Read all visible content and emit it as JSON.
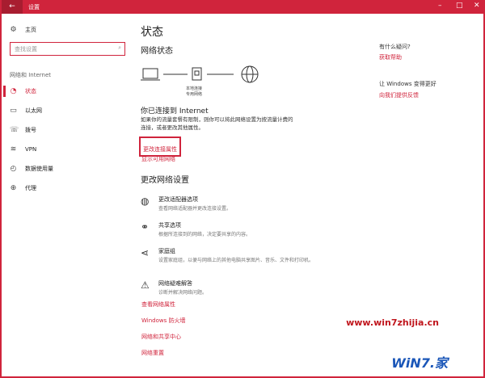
{
  "window": {
    "title": "设置",
    "minimize": "–",
    "maximize": "□",
    "close": "✕"
  },
  "sidebar": {
    "home": "主页",
    "search_placeholder": "查找设置",
    "section": "网络和 Internet",
    "items": [
      {
        "label": "状态",
        "icon": "status-icon"
      },
      {
        "label": "以太网",
        "icon": "ethernet-icon"
      },
      {
        "label": "拨号",
        "icon": "dialup-icon"
      },
      {
        "label": "VPN",
        "icon": "vpn-icon"
      },
      {
        "label": "数据使用量",
        "icon": "data-usage-icon"
      },
      {
        "label": "代理",
        "icon": "proxy-icon"
      }
    ]
  },
  "main": {
    "title": "状态",
    "network_status": "网络状态",
    "network_label_1": "本地连接",
    "network_label_2": "专用网络",
    "connected": "你已连接到 Internet",
    "connected_desc": "如果你的流量套餐有限制，则你可以将此网络设置为按流量计费的连接，或者更改其他属性。",
    "change_props": "更改连接属性",
    "show_networks": "显示可用网络",
    "change_settings": "更改网络设置",
    "options": [
      {
        "title": "更改适配器选项",
        "desc": "查看网络适配器并更改连接设置。",
        "icon": "adapter-icon"
      },
      {
        "title": "共享选项",
        "desc": "根据所连接到的网络，决定要共享的内容。",
        "icon": "sharing-icon"
      },
      {
        "title": "家庭组",
        "desc": "设置家庭组，以便与网络上的其他电脑共享图片、音乐、文件和打印机。",
        "icon": "homegroup-icon"
      },
      {
        "title": "网络疑难解答",
        "desc": "诊断并解决网络问题。",
        "icon": "warning-icon"
      }
    ],
    "links": [
      "查看网络属性",
      "Windows 防火墙",
      "网络和共享中心",
      "网络重置"
    ]
  },
  "right": {
    "question": "有什么疑问?",
    "help": "获取帮助",
    "improve": "让 Windows 变得更好",
    "feedback": "向我们提供反馈"
  },
  "watermark": {
    "url": "www.win7zhijia.cn",
    "logo": "WiN7.家"
  }
}
